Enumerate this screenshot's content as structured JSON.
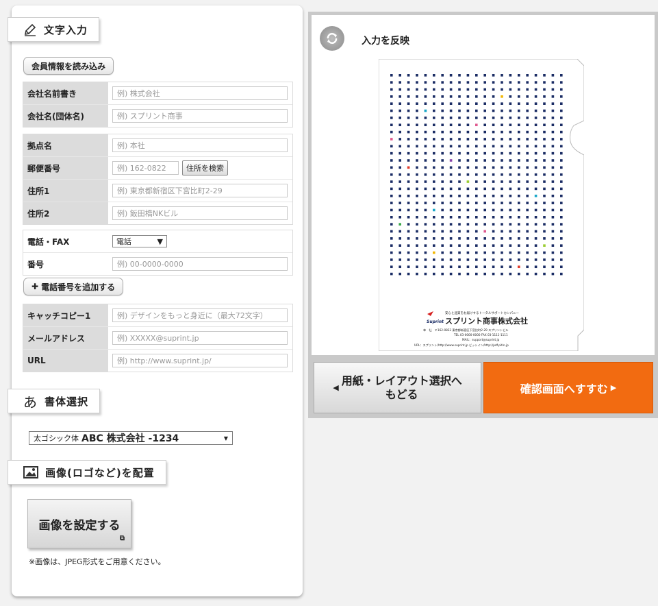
{
  "text_input": {
    "title": "文字入力",
    "load_member_button": "会員情報を読み込み",
    "rows": {
      "company_prefix": {
        "label": "会社名前書き",
        "placeholder": "例) 株式会社"
      },
      "company_name": {
        "label": "会社名(団体名)",
        "placeholder": "例) スプリント商事"
      },
      "branch": {
        "label": "拠点名",
        "placeholder": "例) 本社"
      },
      "postal": {
        "label": "郵便番号",
        "placeholder": "例) 162-0822",
        "button": "住所を検索"
      },
      "address1": {
        "label": "住所1",
        "placeholder": "例) 東京都新宿区下宮比町2-29"
      },
      "address2": {
        "label": "住所2",
        "placeholder": "例) 飯田橋NKビル"
      },
      "phone_type": {
        "label": "電話・FAX",
        "value": "電話"
      },
      "phone_number": {
        "label": "番号",
        "placeholder": "例) 00-0000-0000"
      },
      "catchcopy": {
        "label": "キャッチコピー1",
        "placeholder": "例) デザインをもっと身近に（最大72文字）"
      },
      "email": {
        "label": "メールアドレス",
        "placeholder": "例) XXXXX@suprint.jp"
      },
      "url": {
        "label": "URL",
        "placeholder": "例) http://www.suprint.jp/"
      }
    },
    "add_phone_button": "電話番号を追加する"
  },
  "font_section": {
    "title": "書体選択",
    "select_small": "太ゴシック体",
    "select_sample": "ABC 株式会社 -1234"
  },
  "image_section": {
    "title": "画像(ロゴなど)を配置",
    "set_button": "画像を設定する",
    "note": "※画像は、JPEG形式をご用意ください。"
  },
  "preview": {
    "refresh_label": "入力を反映",
    "doc": {
      "tagline": "安心と品質をお届けするトータルサポートカンパニー",
      "logo_text": "Suprint",
      "company": "スプリント商事株式会社",
      "line1": "本　社　〒162-0822 東京都新宿区下宮比町2-29 スプリントビル",
      "line2": "TEL 03-0000-0000 FAX 03-1111-1111",
      "line3": "MAIL：support@suprint.jp",
      "line4": "URL：スプリント/http://www.suprint.jp ビットイン/http://pdf-pitin.jp"
    }
  },
  "nav": {
    "back_line1": "用紙・レイアウト選択へ",
    "back_line2": "もどる",
    "confirm": "確認画面へすすむ"
  }
}
